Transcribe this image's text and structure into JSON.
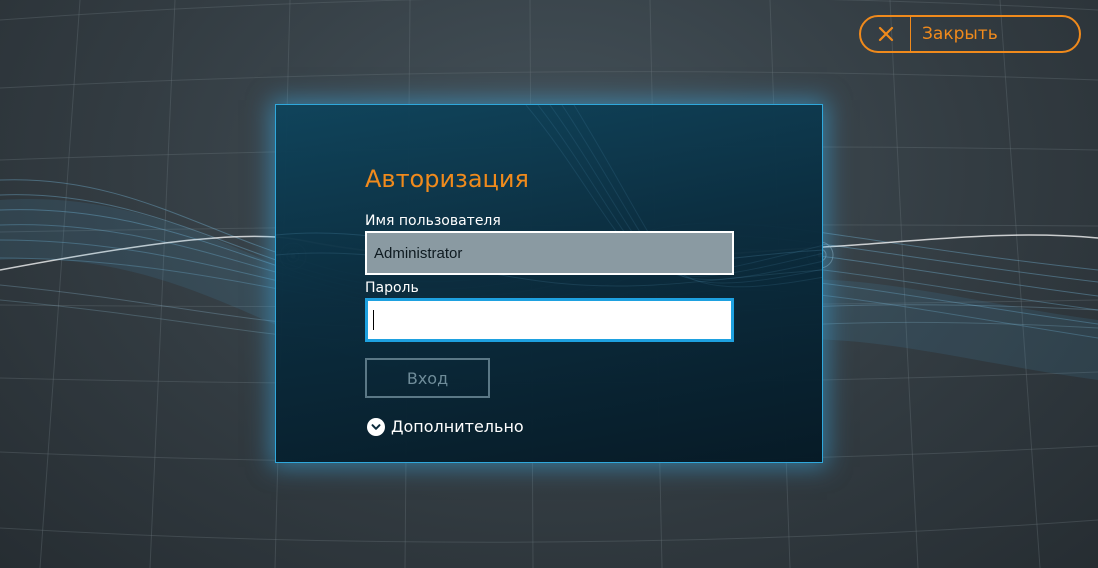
{
  "close_button": {
    "label": "Закрыть",
    "icon": "close-icon",
    "color": "#f08a1c"
  },
  "login_dialog": {
    "title": "Авторизация",
    "username": {
      "label": "Имя пользователя",
      "value": "Administrator"
    },
    "password": {
      "label": "Пароль",
      "value": ""
    },
    "submit_label": "Вход",
    "more_label": "Дополнительно",
    "more_icon": "chevron-down-icon"
  },
  "colors": {
    "accent": "#f08a1c",
    "focus_border": "#1ea1e0",
    "dialog_border": "#2fa8dc"
  }
}
